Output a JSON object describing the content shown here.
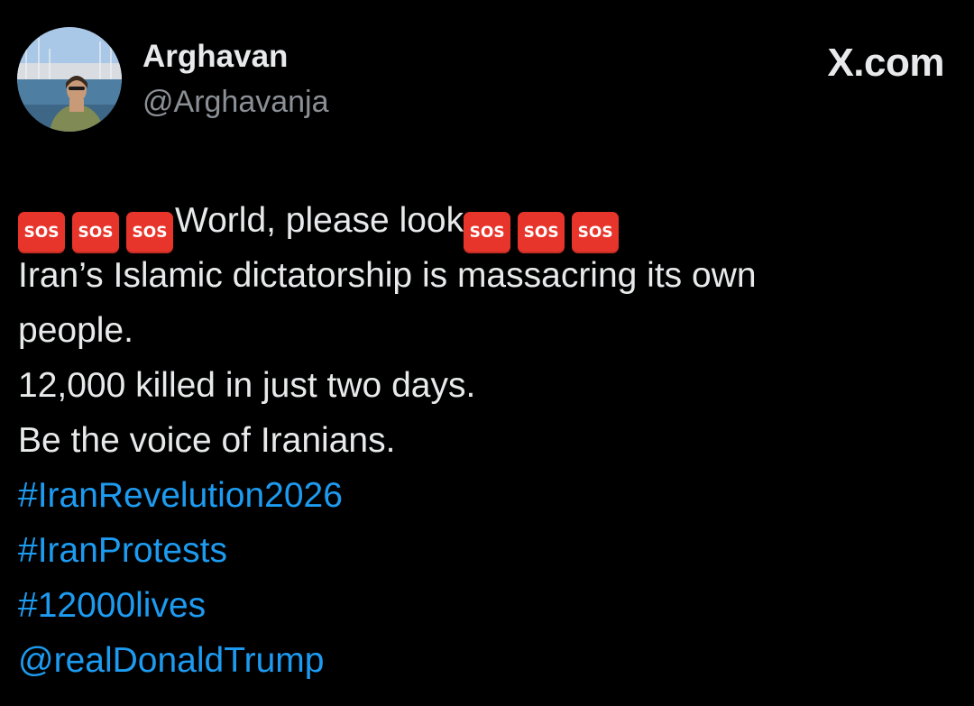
{
  "header": {
    "display_name": "Arghavan",
    "handle": "@Arghavanja",
    "brand_label": "X.com"
  },
  "tweet": {
    "sos_label": "SOS",
    "headline_text": "World, please look",
    "lines": [
      "Iran’s Islamic dictatorship is massacring its own",
      "people.",
      "12,000 killed in just two days.",
      "Be the voice of Iranians."
    ],
    "hashtags": [
      "#IranRevelution2026",
      "#IranProtests",
      "#12000lives"
    ],
    "mention": "@realDonaldTrump"
  },
  "colors": {
    "background": "#000000",
    "text": "#e7e9ea",
    "handle": "#8b9096",
    "link": "#1d9bf0",
    "sos_badge": "#e8352b"
  },
  "icons": {
    "sos": "sos-button-emoji",
    "avatar": "profile-photo"
  }
}
